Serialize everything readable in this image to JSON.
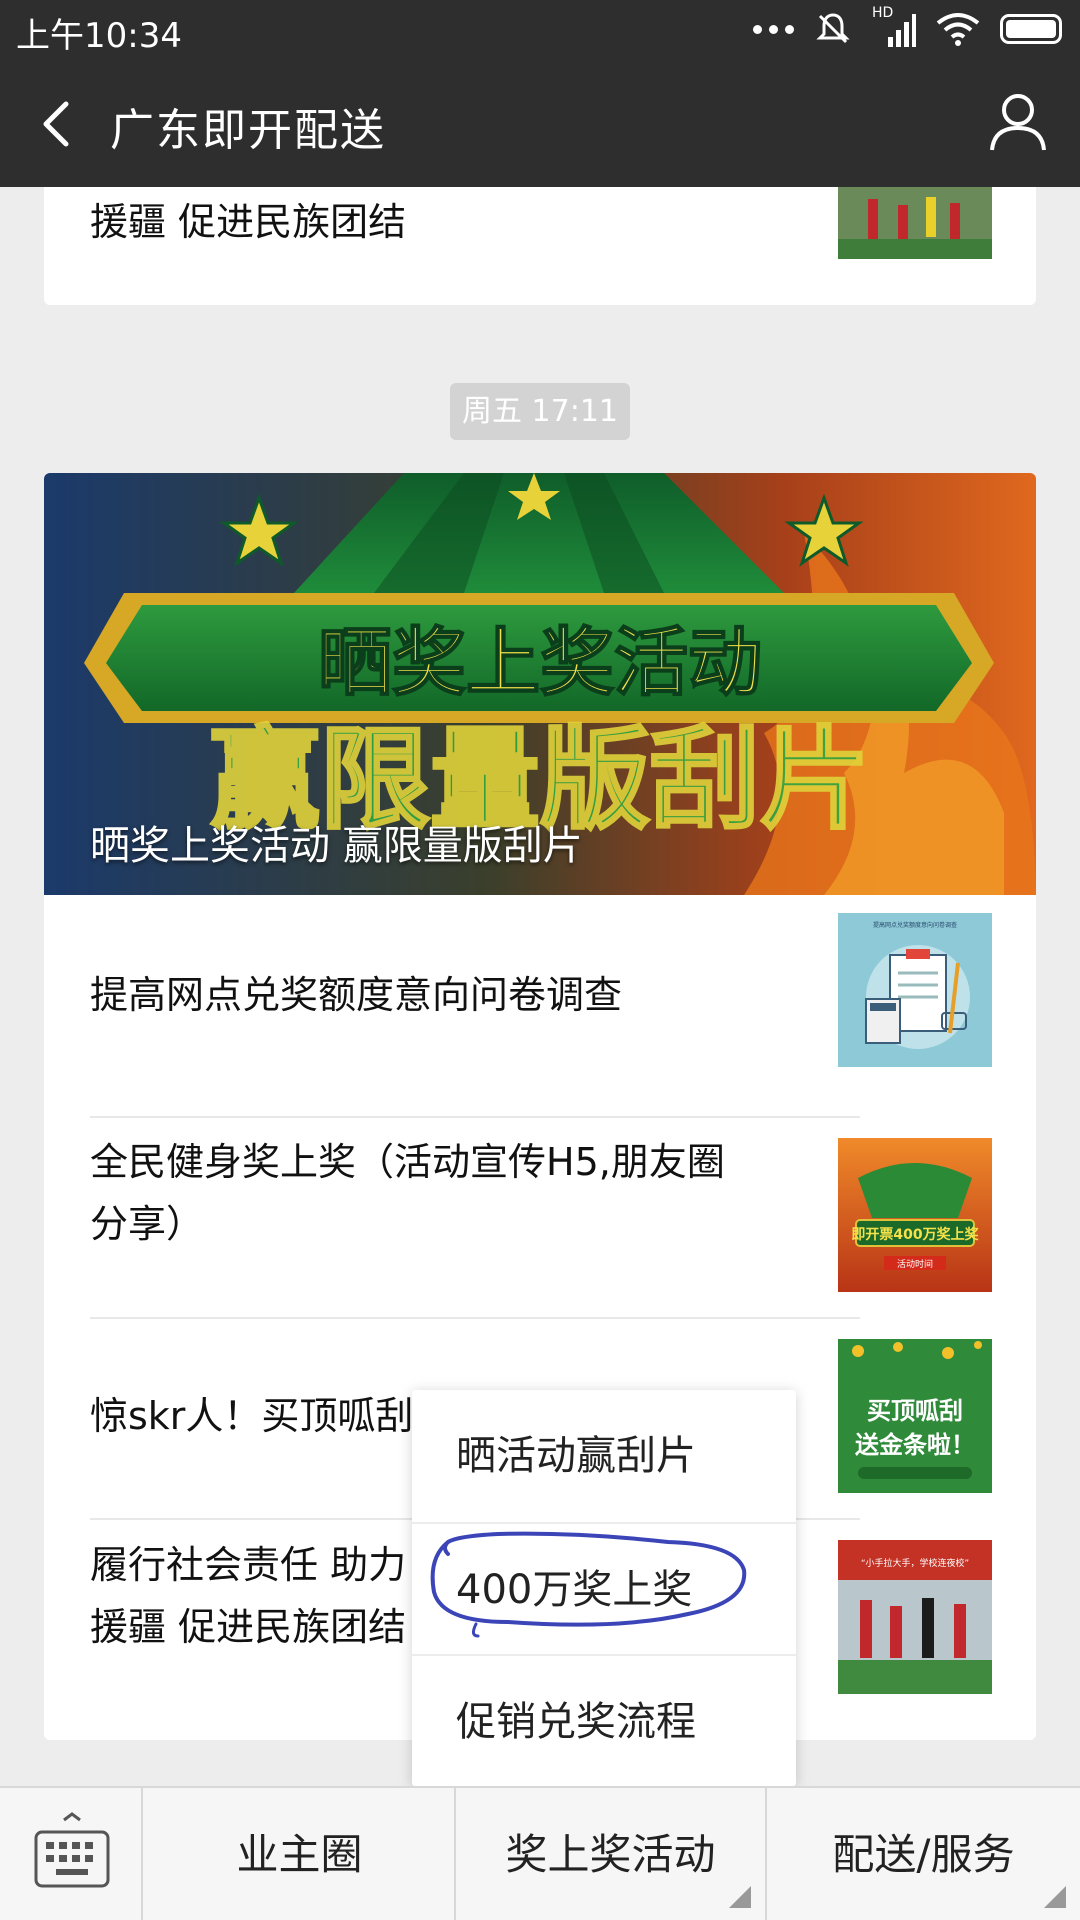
{
  "status_bar": {
    "time": "上午10:34",
    "network_label": "HD"
  },
  "nav": {
    "title": "广东即开配送"
  },
  "feed": {
    "prev_item_title": "援疆 促进民族团结",
    "timestamp": "周五 17:11",
    "banner": {
      "headline_line1": "晒奖上奖活动",
      "headline_line2": "赢限量版刮片",
      "caption": "晒奖上奖活动 赢限量版刮片"
    },
    "items": [
      {
        "title": "提高网点兑奖额度意向问卷调查",
        "thumb_text": "提高网点兑奖额度意向问卷调查"
      },
      {
        "title_line1": "全民健身奖上奖（活动宣传H5,朋友圈",
        "title_line2": "分享）",
        "thumb_text": "即开票400万奖上奖",
        "thumb_subtext": "活动时间"
      },
      {
        "title": "惊skr人！买顶呱刮",
        "thumb_text_1": "买顶呱刮",
        "thumb_text_2": "送金条啦！"
      },
      {
        "title_line1": "履行社会责任 助力",
        "title_line2": "援疆 促进民族团结",
        "thumb_text": "“小手拉大手，学校连夜校”"
      }
    ]
  },
  "popup_menu": {
    "items": [
      "晒活动赢刮片",
      "400万奖上奖",
      "促销兑奖流程"
    ],
    "annotated_item_index": 1
  },
  "bottom_menu": {
    "tabs": [
      "业主圈",
      "奖上奖活动",
      "配送/服务"
    ]
  },
  "colors": {
    "header_bg": "#2e2e2e",
    "page_bg": "#ededed",
    "annotation_stroke": "#3b45b8"
  }
}
